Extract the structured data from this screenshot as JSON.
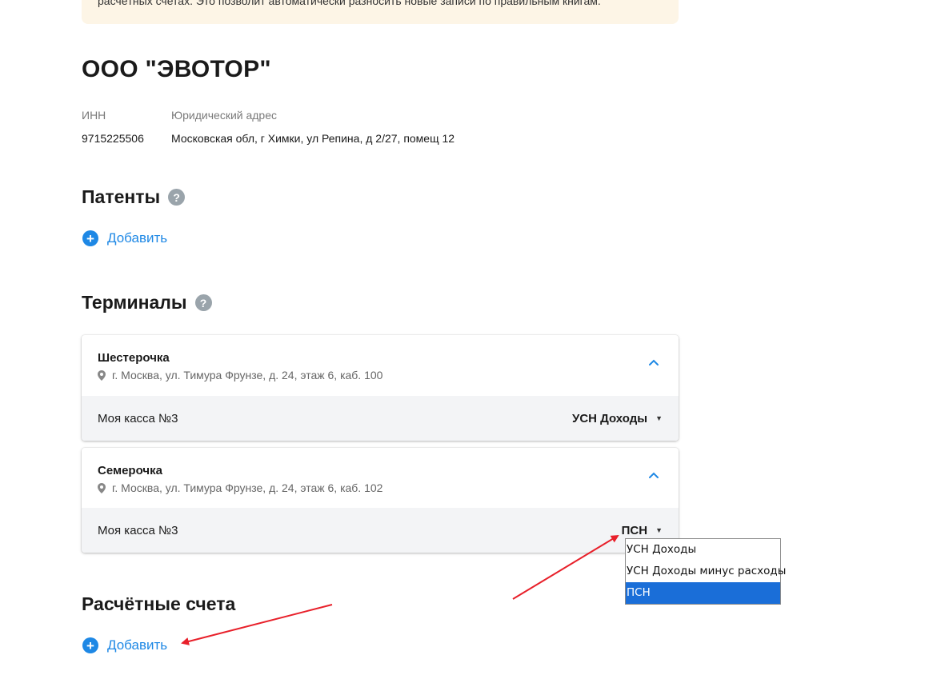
{
  "notice": {
    "text": "расчётных счетах. Это позволит автоматически разносить новые записи по правильным книгам."
  },
  "organization": {
    "title": "ООО \"ЭВОТОР\"",
    "inn_label": "ИНН",
    "inn_value": "9715225506",
    "address_label": "Юридический адрес",
    "address_value": "Московская обл, г Химки, ул Репина, д 2/27, помещ 12"
  },
  "patents": {
    "title": "Патенты",
    "help_symbol": "?",
    "add_label": "Добавить"
  },
  "terminals": {
    "title": "Терминалы",
    "help_symbol": "?",
    "items": [
      {
        "name": "Шестерочка",
        "address": "г. Москва, ул. Тимура Фрунзе, д. 24, этаж 6, каб. 100",
        "kassa": "Моя касса №3",
        "tax": "УСН Доходы"
      },
      {
        "name": "Семерочка",
        "address": "г. Москва, ул. Тимура Фрунзе, д. 24, этаж 6, каб. 102",
        "kassa": "Моя касса №3",
        "tax": "ПСН"
      }
    ]
  },
  "dropdown": {
    "options": [
      "УСН Доходы",
      "УСН Доходы минус расходы",
      "ПСН"
    ],
    "selected": "ПСН"
  },
  "accounts": {
    "title": "Расчётные счета",
    "add_label": "Добавить"
  },
  "colors": {
    "accent": "#1e88e5",
    "annotation_arrow": "#e8202a",
    "notice_bg": "#fdf5e6",
    "dropdown_selected": "#1a6ed8"
  },
  "icons": {
    "help": "question-circle-icon",
    "add": "plus-circle-icon",
    "pin": "map-pin-icon",
    "chevron": "chevron-up-icon",
    "caret": "caret-down-icon"
  }
}
